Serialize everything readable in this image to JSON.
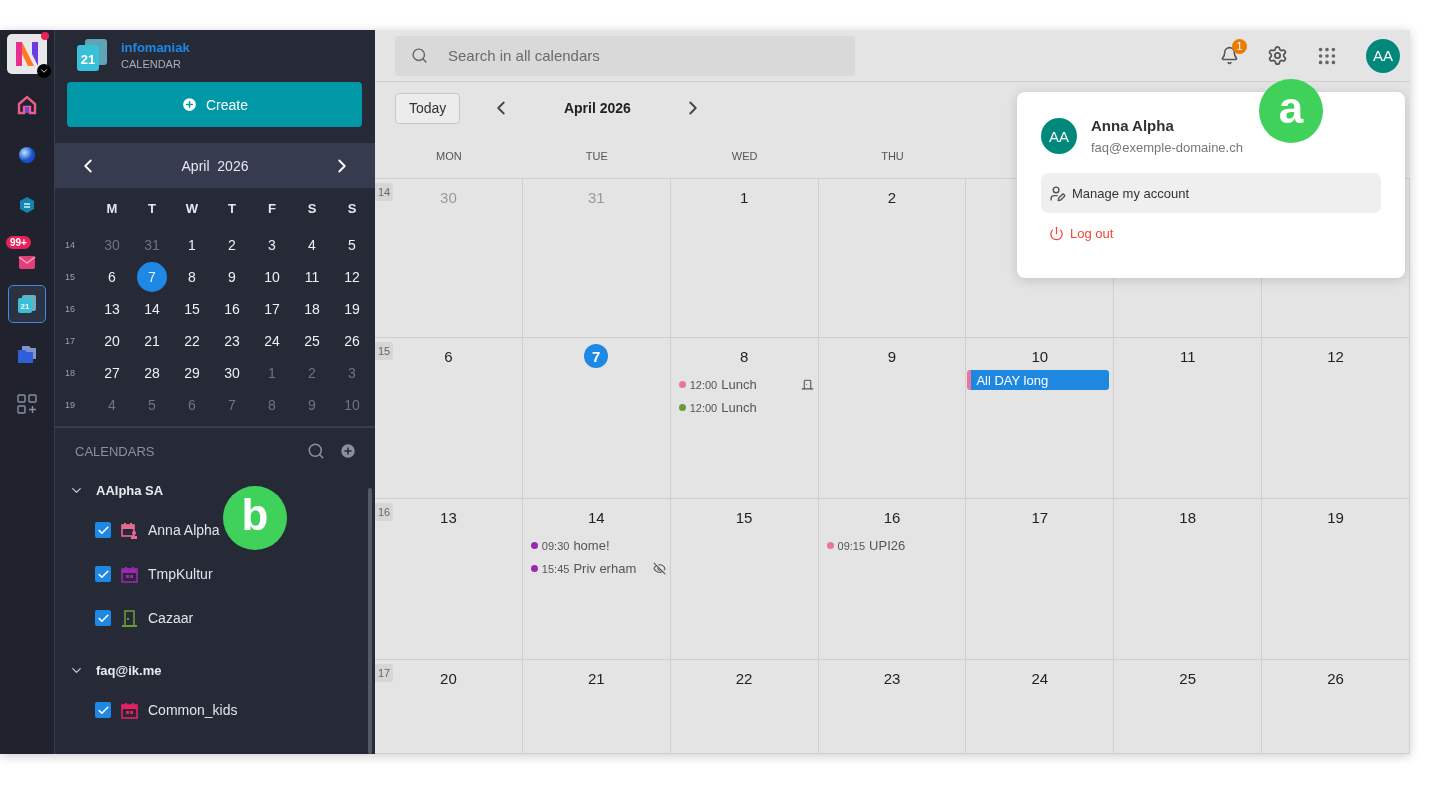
{
  "rail": {
    "items": [
      {
        "kind": "home",
        "selected": false
      },
      {
        "kind": "sphere",
        "selected": false
      },
      {
        "kind": "chat",
        "selected": false
      },
      {
        "kind": "mail",
        "selected": false,
        "badge": "99+"
      },
      {
        "kind": "calendar",
        "selected": true,
        "label": "21"
      },
      {
        "kind": "folder",
        "selected": false
      },
      {
        "kind": "apps",
        "selected": false
      }
    ]
  },
  "brand": {
    "name": "infomaniak",
    "product": "CALENDAR",
    "logo_text": "21"
  },
  "create_button": "Create",
  "mini_calendar": {
    "title": "April  2026",
    "weekdays": [
      "M",
      "T",
      "W",
      "T",
      "F",
      "S",
      "S"
    ],
    "weeks": [
      {
        "number": "14",
        "days": [
          {
            "label": "30",
            "muted": true,
            "selected": false
          },
          {
            "label": "31",
            "muted": true,
            "selected": false
          },
          {
            "label": "1",
            "muted": false,
            "selected": false
          },
          {
            "label": "2",
            "muted": false,
            "selected": false
          },
          {
            "label": "3",
            "muted": false,
            "selected": false
          },
          {
            "label": "4",
            "muted": false,
            "selected": false
          },
          {
            "label": "5",
            "muted": false,
            "selected": false
          }
        ]
      },
      {
        "number": "15",
        "days": [
          {
            "label": "6",
            "muted": false,
            "selected": false
          },
          {
            "label": "7",
            "muted": false,
            "selected": true
          },
          {
            "label": "8",
            "muted": false,
            "selected": false
          },
          {
            "label": "9",
            "muted": false,
            "selected": false
          },
          {
            "label": "10",
            "muted": false,
            "selected": false
          },
          {
            "label": "11",
            "muted": false,
            "selected": false
          },
          {
            "label": "12",
            "muted": false,
            "selected": false
          }
        ]
      },
      {
        "number": "16",
        "days": [
          {
            "label": "13",
            "muted": false,
            "selected": false
          },
          {
            "label": "14",
            "muted": false,
            "selected": false
          },
          {
            "label": "15",
            "muted": false,
            "selected": false
          },
          {
            "label": "16",
            "muted": false,
            "selected": false
          },
          {
            "label": "17",
            "muted": false,
            "selected": false
          },
          {
            "label": "18",
            "muted": false,
            "selected": false
          },
          {
            "label": "19",
            "muted": false,
            "selected": false
          }
        ]
      },
      {
        "number": "17",
        "days": [
          {
            "label": "20",
            "muted": false,
            "selected": false
          },
          {
            "label": "21",
            "muted": false,
            "selected": false
          },
          {
            "label": "22",
            "muted": false,
            "selected": false
          },
          {
            "label": "23",
            "muted": false,
            "selected": false
          },
          {
            "label": "24",
            "muted": false,
            "selected": false
          },
          {
            "label": "25",
            "muted": false,
            "selected": false
          },
          {
            "label": "26",
            "muted": false,
            "selected": false
          }
        ]
      },
      {
        "number": "18",
        "days": [
          {
            "label": "27",
            "muted": false,
            "selected": false
          },
          {
            "label": "28",
            "muted": false,
            "selected": false
          },
          {
            "label": "29",
            "muted": false,
            "selected": false
          },
          {
            "label": "30",
            "muted": false,
            "selected": false
          },
          {
            "label": "1",
            "muted": true,
            "selected": false
          },
          {
            "label": "2",
            "muted": true,
            "selected": false
          },
          {
            "label": "3",
            "muted": true,
            "selected": false
          }
        ]
      },
      {
        "number": "19",
        "days": [
          {
            "label": "4",
            "muted": true,
            "selected": false
          },
          {
            "label": "5",
            "muted": true,
            "selected": false
          },
          {
            "label": "6",
            "muted": true,
            "selected": false
          },
          {
            "label": "7",
            "muted": true,
            "selected": false
          },
          {
            "label": "8",
            "muted": true,
            "selected": false
          },
          {
            "label": "9",
            "muted": true,
            "selected": false
          },
          {
            "label": "10",
            "muted": true,
            "selected": false
          }
        ]
      }
    ]
  },
  "calendars": {
    "title": "CALENDARS",
    "groups": [
      {
        "name": "AAlpha SA",
        "expanded": true,
        "items": [
          {
            "name": "Anna Alpha",
            "checked": true,
            "kind": "personal",
            "color": "#e86a92"
          },
          {
            "name": "TmpKultur",
            "checked": true,
            "kind": "shared",
            "color": "#9c27b0"
          },
          {
            "name": "Cazaar",
            "checked": true,
            "kind": "room",
            "color": "#6a9a3a"
          }
        ]
      },
      {
        "name": "faq@ik.me",
        "expanded": true,
        "items": [
          {
            "name": "Common_kids",
            "checked": true,
            "kind": "shared",
            "color": "#e91e63"
          }
        ]
      }
    ]
  },
  "search": {
    "placeholder": "Search in all calendars"
  },
  "notifications": {
    "count": "1"
  },
  "avatar": {
    "initials": "AA"
  },
  "toolbar": {
    "today": "Today",
    "title": "April 2026"
  },
  "month": {
    "weekdays": [
      "MON",
      "TUE",
      "WED",
      "THU"
    ],
    "weeks": [
      {
        "number": "14",
        "days": [
          {
            "day": "30",
            "muted": true,
            "today": false
          },
          {
            "day": "31",
            "muted": true,
            "today": false
          },
          {
            "day": "1",
            "muted": false,
            "today": false
          },
          {
            "day": "2",
            "muted": false,
            "today": false
          }
        ]
      },
      {
        "number": "15",
        "days": [
          {
            "day": "6",
            "muted": false,
            "today": false
          },
          {
            "day": "7",
            "muted": false,
            "today": true
          },
          {
            "day": "8",
            "muted": false,
            "today": false,
            "events": [
              {
                "kind": "timed",
                "time": "12:00",
                "title": "Lunch",
                "color": "#e8769b",
                "room": true,
                "private": false
              },
              {
                "kind": "timed",
                "time": "12:00",
                "title": "Lunch",
                "color": "#6a9a3a",
                "room": false,
                "private": false
              }
            ]
          },
          {
            "day": "9",
            "muted": false,
            "today": false
          },
          {
            "day": "10",
            "muted": false,
            "today": false,
            "events": [
              {
                "kind": "allday",
                "title": "All DAY long",
                "color": "#e8769b"
              }
            ]
          },
          {
            "day": "11",
            "muted": false,
            "today": false
          },
          {
            "day": "12",
            "muted": false,
            "today": false
          }
        ]
      },
      {
        "number": "16",
        "days": [
          {
            "day": "13",
            "muted": false,
            "today": false
          },
          {
            "day": "14",
            "muted": false,
            "today": false,
            "events": [
              {
                "kind": "timed",
                "time": "09:30",
                "title": "home!",
                "color": "#9c27b0",
                "room": false,
                "private": false
              },
              {
                "kind": "timed",
                "time": "15:45",
                "title": "Priv erham",
                "color": "#9c27b0",
                "room": false,
                "private": true
              }
            ]
          },
          {
            "day": "15",
            "muted": false,
            "today": false
          },
          {
            "day": "16",
            "muted": false,
            "today": false,
            "events": [
              {
                "kind": "timed",
                "time": "09:15",
                "title": "UPI26",
                "color": "#e8769b",
                "room": false,
                "private": false
              }
            ]
          },
          {
            "day": "17",
            "muted": false,
            "today": false
          },
          {
            "day": "18",
            "muted": false,
            "today": false
          },
          {
            "day": "19",
            "muted": false,
            "today": false
          }
        ]
      },
      {
        "number": "17",
        "days": [
          {
            "day": "20",
            "muted": false,
            "today": false
          },
          {
            "day": "21",
            "muted": false,
            "today": false
          },
          {
            "day": "22",
            "muted": false,
            "today": false
          },
          {
            "day": "23",
            "muted": false,
            "today": false
          },
          {
            "day": "24",
            "muted": false,
            "today": false
          },
          {
            "day": "25",
            "muted": false,
            "today": false
          },
          {
            "day": "26",
            "muted": false,
            "today": false
          }
        ]
      }
    ]
  },
  "account_menu": {
    "initials": "AA",
    "name": "Anna Alpha",
    "email": "faq@exemple-domaine.ch",
    "items": [
      {
        "kind": "manage",
        "label": "Manage my account",
        "selected": true
      },
      {
        "kind": "logout",
        "label": "Log out",
        "selected": false
      }
    ]
  },
  "markers": [
    {
      "label": "a"
    },
    {
      "label": "b"
    }
  ]
}
